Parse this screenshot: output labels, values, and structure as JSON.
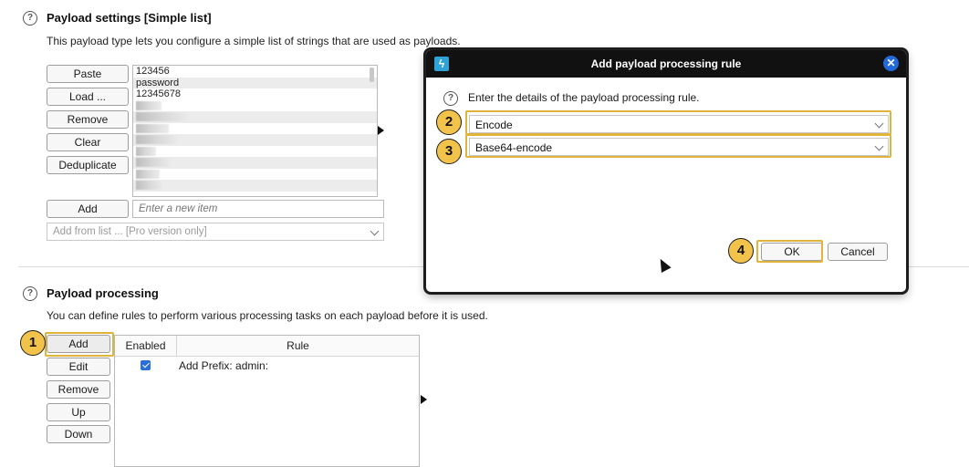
{
  "payload_settings": {
    "title": "Payload settings [Simple list]",
    "description": "This payload type lets you configure a simple list of strings that are used as payloads.",
    "buttons": {
      "paste": "Paste",
      "load": "Load ...",
      "remove": "Remove",
      "clear": "Clear",
      "deduplicate": "Deduplicate",
      "add": "Add"
    },
    "list_items": [
      "123456",
      "password",
      "12345678"
    ],
    "new_item_placeholder": "Enter a new item",
    "add_from_list": "Add from list ... [Pro version only]"
  },
  "payload_processing": {
    "title": "Payload processing",
    "description": "You can define rules to perform various processing tasks on each payload before it is used.",
    "buttons": {
      "add": "Add",
      "edit": "Edit",
      "remove": "Remove",
      "up": "Up",
      "down": "Down"
    },
    "table": {
      "columns": [
        "Enabled",
        "Rule"
      ],
      "rows": [
        {
          "enabled": true,
          "rule": "Add Prefix: admin:"
        }
      ]
    }
  },
  "dialog": {
    "title": "Add payload processing rule",
    "prompt": "Enter the details of the payload processing rule.",
    "rule_type": "Encode",
    "encoding": "Base64-encode",
    "ok_label": "OK",
    "cancel_label": "Cancel"
  },
  "callouts": [
    "1",
    "2",
    "3",
    "4"
  ],
  "colors": {
    "highlight": "#e0b43a",
    "badge": "#f2c34a",
    "checkbox": "#2b6fd6",
    "dialog_titlebar": "#111111"
  }
}
